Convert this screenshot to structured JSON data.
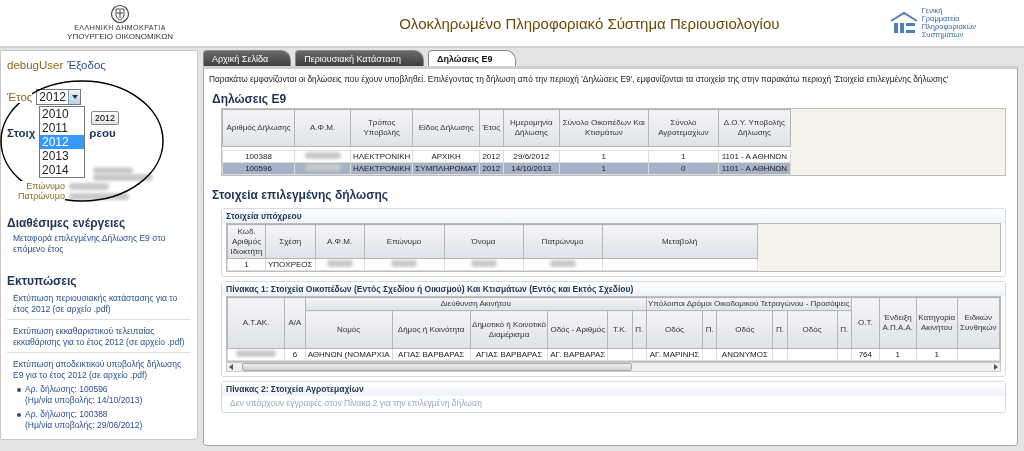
{
  "header": {
    "ministry": [
      "ΕΛΛΗΝΙΚΗ ΔΗΜΟΚΡΑΤΙΑ",
      "ΥΠΟΥΡΓΕΙΟ ΟΙΚΟΝΟΜΙΚΩΝ"
    ],
    "title": "Ολοκληρωμένο Πληροφοριακό Σύστημα Περιουσιολογίου",
    "agency": [
      "Γενική",
      "Γραμματεία",
      "Πληροφοριακών",
      "Συστημάτων"
    ]
  },
  "sidebar": {
    "user": "debugUser",
    "logout": "Έξοδος",
    "year_label": "Έτος",
    "year_value": "2012",
    "year_options": [
      {
        "label": "2010",
        "selected": false
      },
      {
        "label": "2011",
        "selected": false
      },
      {
        "label": "2012",
        "selected": true
      },
      {
        "label": "2013",
        "selected": false
      },
      {
        "label": "2014",
        "selected": false
      }
    ],
    "tooltip": "2012",
    "taxpayer": {
      "title_parts": [
        "Στοιχ",
        "ρεου"
      ],
      "rows": [
        {
          "kind": "unlabeled"
        },
        {
          "kind": "unlabeled"
        },
        {
          "kind": "labeled",
          "label": "Επώνυμο"
        },
        {
          "kind": "labeled",
          "label": "Πατρώνυμο"
        }
      ]
    },
    "actions": {
      "title": "Διαθέσιμες ενέργειες",
      "links": [
        "Μεταφορά επιλεγμένης Δήλωσης Ε9 στο επόμενο έτος"
      ]
    },
    "prints": {
      "title": "Εκτυπώσεις",
      "items": [
        {
          "text": "Εκτύπωση περιουσιακής κατάστασης για το έτος 2012 (σε αρχείο .pdf)"
        },
        {
          "text": "Εκτύπωση εκκαθαριστικού τελευταίας εκκαθάρισης για το έτος 2012 (σε αρχείο .pdf)"
        },
        {
          "text": "Εκτύπωση αποδεικτικού υποβολής δήλωσης Ε9 για το έτος 2012 (σε αρχείο .pdf)",
          "children": [
            {
              "number": "Αρ. δήλωσης: 100596",
              "date": "(Ημ/νία υποβολής: 14/10/2013)"
            },
            {
              "number": "Αρ. δήλωσης: 100388",
              "date": "(Ημ/νία υποβολής: 29/06/2012)"
            }
          ]
        }
      ]
    }
  },
  "tabs": [
    {
      "label": "Αρχική Σελίδα",
      "selected": false
    },
    {
      "label": "Περιουσιακή Κατάσταση",
      "selected": false
    },
    {
      "label": "Δηλώσεις Ε9",
      "selected": true
    }
  ],
  "intro": "Παρακάτω εμφανίζονται οι δηλώσεις που έχουν υποβληθεί. Επιλέγοντας τη δήλωση από την περιοχή 'Δηλώσεις Ε9', εμφανίζονται τα στοιχεία της στην παρακάτω περιοχή 'Στοιχεία επιλεγμένης δήλωσης'",
  "declarations": {
    "title": "Δηλώσεις Ε9",
    "columns": [
      "Αριθμός Δήλωσης",
      "Α.Φ.Μ.",
      "Τρόπος Υποβολής",
      "Είδος Δήλωσης",
      "Έτος",
      "Ημερομηνία Δήλωσης",
      "Σύνολο Οικοπέδων Και Κτισμάτων",
      "Σύνολο Αγροτεμαχίων",
      "Δ.Ο.Υ. Υποβολής Δήλωσης"
    ],
    "rows": [
      {
        "selected": false,
        "cells": [
          "100388",
          {
            "kind": "blurred"
          },
          "ΗΛΕΚΤΡΟΝΙΚΗ",
          "ΑΡΧΙΚΗ",
          "2012",
          "29/6/2012",
          "1",
          "1",
          "1101 - Α ΑΘΗΝΩΝ"
        ]
      },
      {
        "selected": true,
        "cells": [
          "100596",
          {
            "kind": "blurred"
          },
          "ΗΛΕΚΤΡΟΝΙΚΗ",
          "ΣΥΜΠΛΗΡΩΜΑΤ",
          "2012",
          "14/10/2013",
          "1",
          "0",
          "1101 - Α ΑΘΗΝΩΝ"
        ]
      }
    ]
  },
  "details": {
    "title": "Στοιχεία επιλεγμένης δήλωσης",
    "taxpayer": {
      "title": "Στοιχεία υπόχρεου",
      "columns": [
        "Κωδ. Αριθμός Ιδιοκτήτη",
        "Σχέση",
        "Α.Φ.Μ.",
        "Επώνυμο",
        "Όνομα",
        "Πατρώνυμο",
        "Μεταβολή"
      ],
      "rows": [
        {
          "cells": [
            "1",
            "ΥΠΟΧΡΕΟΣ",
            {
              "kind": "blurred"
            },
            {
              "kind": "blurred"
            },
            {
              "kind": "blurred"
            },
            {
              "kind": "blurred"
            },
            null
          ]
        }
      ]
    },
    "plots": {
      "title": "Πίνακας 1: Στοιχεία Οικοπέδων (Εντός Σχεδίου ή Οικισμού) Και Κτισμάτων (Εντός και Εκτός Σχεδίου)",
      "header_rows": [
        [
          {
            "label": "Α.Τ.ΑΚ.",
            "rowspan": 2
          },
          {
            "label": "Α/Α",
            "rowspan": 2
          },
          {
            "label": "Διεύθυνση Ακινήτου",
            "colspan": 6
          },
          {
            "label": "Υπόλοιποι Δρόμοι Οικοδομικού Τετραγώνου - Προσόψεις",
            "colspan": 6
          },
          {
            "label": "Ο.Τ.",
            "rowspan": 2
          },
          {
            "label": "Ένδειξη Α.Π.Α.Α.",
            "rowspan": 2
          },
          {
            "label": "Κατηγορία Ακινήτου",
            "rowspan": 2
          },
          {
            "label": "Ειδικών Συνθηκών",
            "rowspan": 2
          }
        ],
        [
          {
            "label": "Νομός"
          },
          {
            "label": "Δήμος ή Κοινότητα"
          },
          {
            "label": "Δημοτικό ή Κοινοτικό Διαμέρισμα"
          },
          {
            "label": "Οδός - Αριθμός"
          },
          {
            "label": "Τ.Κ."
          },
          {
            "label": "Π."
          },
          {
            "label": "Οδός"
          },
          {
            "label": "Π."
          },
          {
            "label": "Οδός"
          },
          {
            "label": "Π."
          },
          {
            "label": "Οδός"
          },
          {
            "label": "Π."
          }
        ]
      ],
      "rows": [
        {
          "cells": [
            {
              "kind": "blurred"
            },
            "6",
            "ΑΘΗΝΩΝ (ΝΟΜΑΡΧΙΑ",
            "ΑΓΙΑΣ ΒΑΡΒΑΡΑΣ",
            "ΑΓΙΑΣ ΒΑΡΒΑΡΑΣ",
            "ΑΓ. ΒΑΡΒΑΡΑΣ",
            null,
            null,
            "ΑΓ. ΜΑΡΙΝΗΣ",
            null,
            "ΑΝΩΝΥΜΟΣ",
            null,
            null,
            null,
            "764",
            "1",
            "1",
            null
          ]
        }
      ]
    },
    "farmland": {
      "title": "Πίνακας 2: Στοιχεία Αγροτεμαχίων",
      "empty_message": "Δεν υπάρχουν εγγραφές στον Πίνακα 2 για την επιλεγμένη δήλωση"
    }
  }
}
